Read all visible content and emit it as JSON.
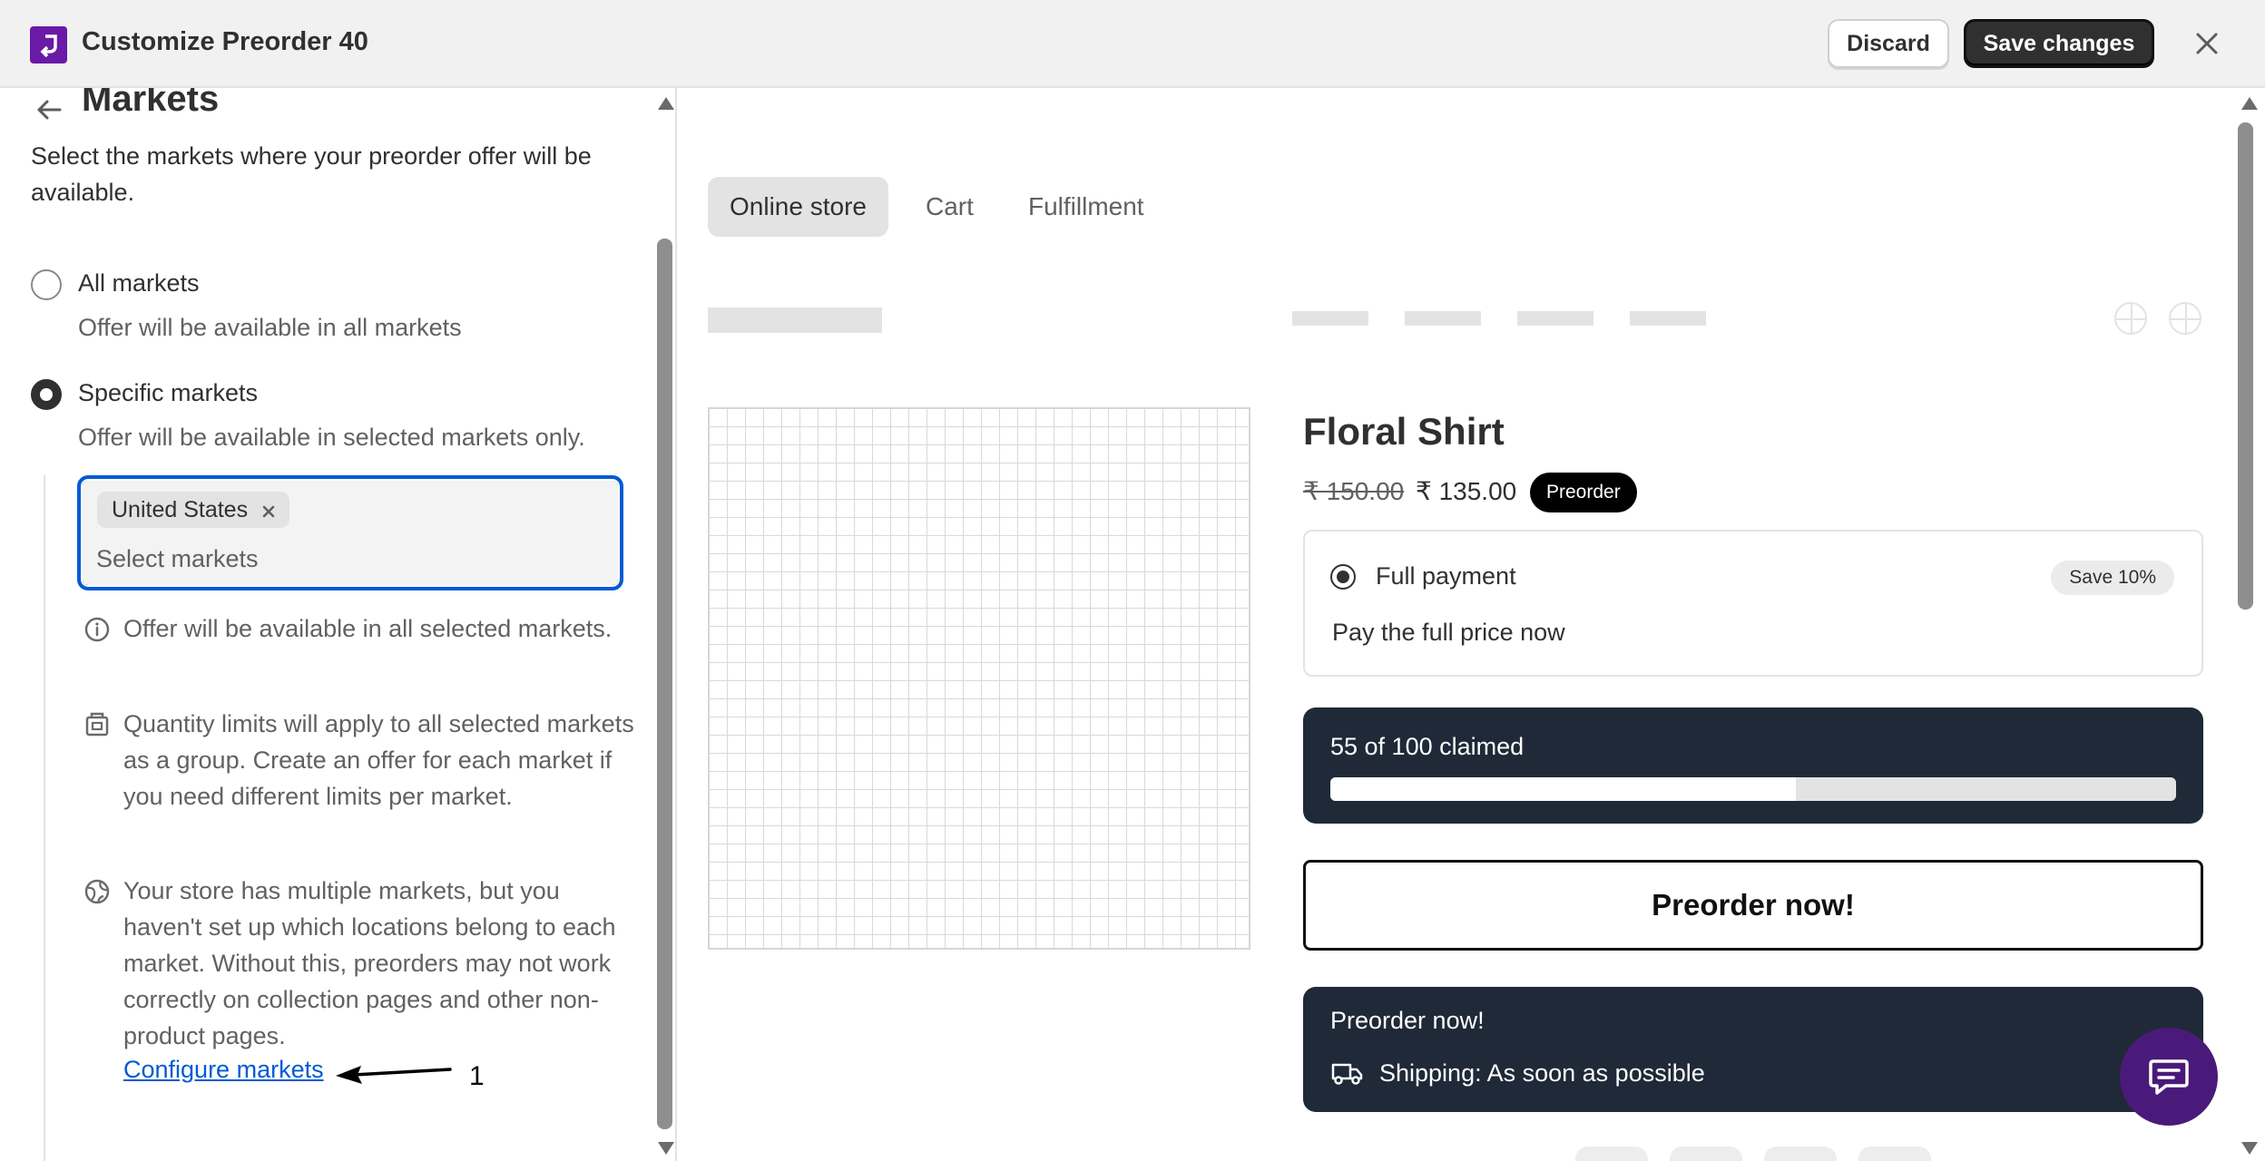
{
  "header": {
    "app_title": "Customize Preorder 40",
    "discard_label": "Discard",
    "save_label": "Save changes",
    "logo_icon": "app-logo-icon",
    "close_icon": "close-icon"
  },
  "sidebar": {
    "back_icon": "arrow-left-icon",
    "heading": "Markets",
    "description": "Select the markets where your preorder offer will be available.",
    "options": [
      {
        "label": "All markets",
        "help": "Offer will be available in all markets",
        "selected": false
      },
      {
        "label": "Specific markets",
        "help": "Offer will be available in selected markets only.",
        "selected": true
      }
    ],
    "market_select": {
      "tags": [
        "United States"
      ],
      "placeholder": "Select markets"
    },
    "notes": [
      {
        "icon": "info-icon",
        "text": "Offer will be available in all selected markets."
      },
      {
        "icon": "inventory-icon",
        "text": "Quantity limits will apply to all selected markets as a group. Create an offer for each market if you need different limits per market."
      },
      {
        "icon": "globe-icon",
        "text": "Your store has multiple markets, but you haven't set up which locations belong to each market. Without this, preorders may not work correctly on collection pages and other non-product pages."
      }
    ],
    "configure_link": "Configure markets",
    "annotation_number": "1"
  },
  "preview": {
    "tabs": [
      {
        "label": "Online store",
        "active": true
      },
      {
        "label": "Cart",
        "active": false
      },
      {
        "label": "Fulfillment",
        "active": false
      }
    ],
    "product": {
      "title": "Floral Shirt",
      "price_old": "₹ 150.00",
      "price_new": "₹ 135.00",
      "badge": "Preorder"
    },
    "payment_option": {
      "title": "Full payment",
      "save_badge": "Save 10%",
      "description": "Pay the full price now",
      "selected": true
    },
    "claimed": {
      "text": "55 of 100 claimed",
      "claimed": 55,
      "total": 100
    },
    "preorder_button": "Preorder now!",
    "shipping_card": {
      "title": "Preorder now!",
      "icon": "truck-icon",
      "text": "Shipping: As soon as possible"
    },
    "chat_icon": "chat-icon"
  },
  "colors": {
    "accent_blue": "#005bd3",
    "app_purple": "#6a1aa6",
    "dark_card": "#1f2937",
    "chat_purple": "#4a1a7a"
  }
}
